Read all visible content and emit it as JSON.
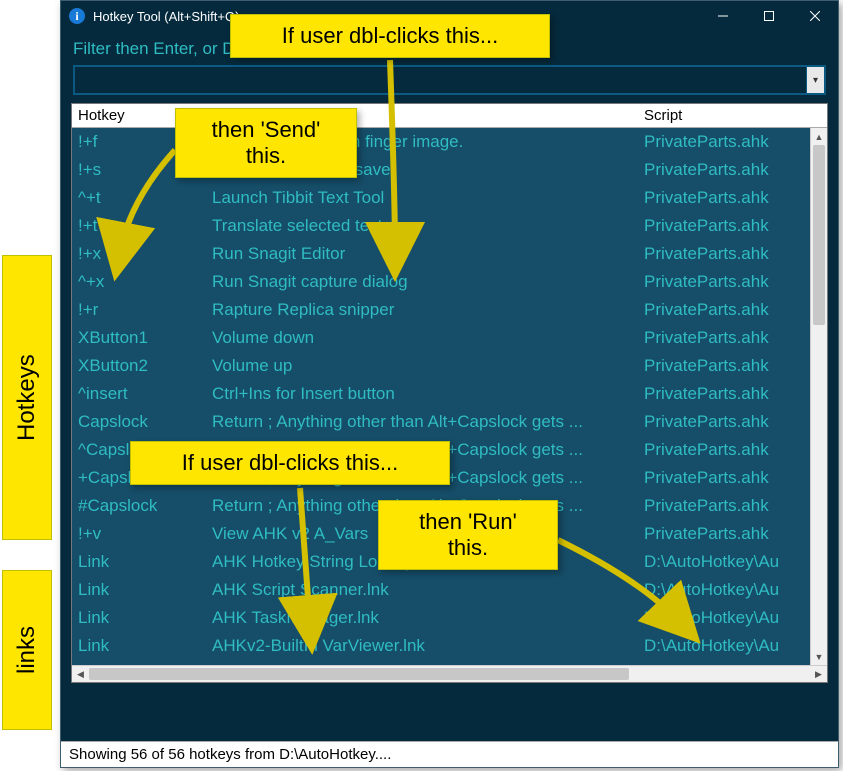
{
  "window": {
    "title": "Hotkey Tool (Alt+Shift+Q)",
    "hint": "Filter then Enter, or Dbl-click. Esc to exit.",
    "status": "Showing 56 of 56 hotkeys from D:\\AutoHotkey...."
  },
  "combo": {
    "value": "",
    "placeholder": ""
  },
  "columns": {
    "hotkey": "Hotkey",
    "desc": "",
    "script": "Script"
  },
  "rows": [
    {
      "hotkey": "!+f",
      "desc": "Point at Mouse with finger image.",
      "script": "PrivateParts.ahk"
    },
    {
      "hotkey": "!+s",
      "desc": "Start Matrix screensaver",
      "script": "PrivateParts.ahk"
    },
    {
      "hotkey": "^+t",
      "desc": "Launch Tibbit Text Tool",
      "script": "PrivateParts.ahk"
    },
    {
      "hotkey": "!+t",
      "desc": "Translate selected text",
      "script": "PrivateParts.ahk"
    },
    {
      "hotkey": "!+x",
      "desc": "Run Snagit Editor",
      "script": "PrivateParts.ahk"
    },
    {
      "hotkey": "^+x",
      "desc": "Run Snagit capture dialog",
      "script": "PrivateParts.ahk"
    },
    {
      "hotkey": "!+r",
      "desc": "Rapture Replica snipper",
      "script": "PrivateParts.ahk"
    },
    {
      "hotkey": "XButton1",
      "desc": "Volume down",
      "script": "PrivateParts.ahk"
    },
    {
      "hotkey": "XButton2",
      "desc": "Volume up",
      "script": "PrivateParts.ahk"
    },
    {
      "hotkey": "^insert",
      "desc": "Ctrl+Ins for Insert button",
      "script": "PrivateParts.ahk"
    },
    {
      "hotkey": "Capslock",
      "desc": "Return ; Anything other than Alt+Capslock gets ...",
      "script": "PrivateParts.ahk"
    },
    {
      "hotkey": "^Capslock",
      "desc": "Return ; Anything other than Alt+Capslock gets ...",
      "script": "PrivateParts.ahk"
    },
    {
      "hotkey": "+Capslock",
      "desc": "Return ; Anything other than Alt+Capslock gets ...",
      "script": "PrivateParts.ahk"
    },
    {
      "hotkey": "#Capslock",
      "desc": "Return ; Anything other than Alt+Capslock gets ...",
      "script": "PrivateParts.ahk"
    },
    {
      "hotkey": "!+v",
      "desc": "View AHK v2 A_Vars",
      "script": "PrivateParts.ahk"
    },
    {
      "hotkey": "Link",
      "desc": "AHK Hotkey String Lookup tool.lnk",
      "script": "D:\\AutoHotkey\\Au"
    },
    {
      "hotkey": "Link",
      "desc": "AHK Script Scanner.lnk",
      "script": "D:\\AutoHotkey\\Au"
    },
    {
      "hotkey": "Link",
      "desc": "AHK TaskManager.lnk",
      "script": "D:\\AutoHotkey\\Au"
    },
    {
      "hotkey": "Link",
      "desc": "AHKv2-BuiltIn VarViewer.lnk",
      "script": "D:\\AutoHotkey\\Au"
    }
  ],
  "sideLabels": {
    "hotkeys": "Hotkeys",
    "links": "links"
  },
  "callouts": {
    "c1": "If user dbl-clicks this...",
    "c2a": "then 'Send'",
    "c2b": "this.",
    "c3": "If user dbl-clicks this...",
    "c4a": "then 'Run'",
    "c4b": "this."
  }
}
